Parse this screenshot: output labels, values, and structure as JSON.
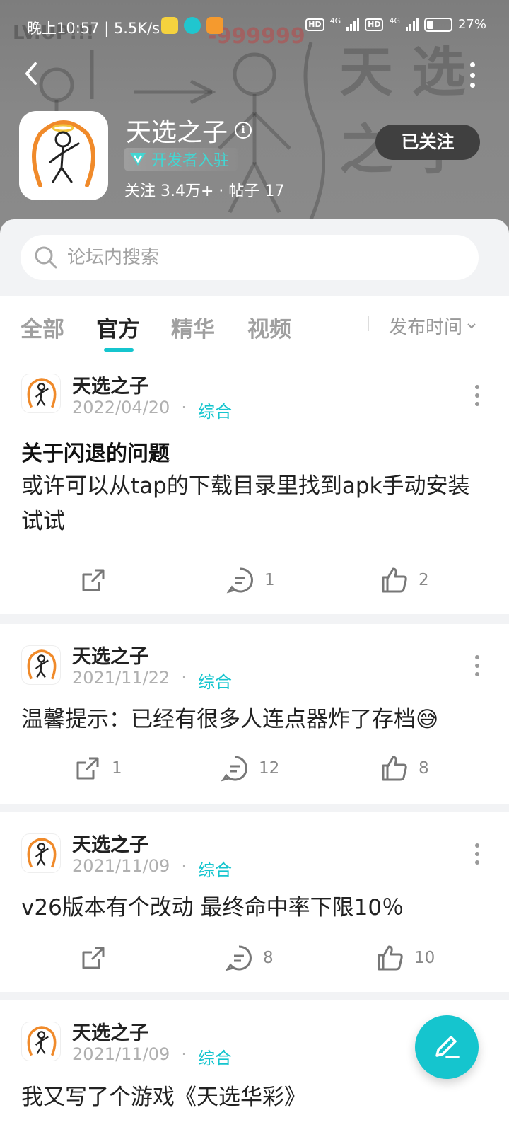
{
  "status_bar": {
    "time": "晚上10:57 | 5.5K/s",
    "hd1": "HD",
    "net1": "4G",
    "hd2": "HD",
    "net2": "4G",
    "battery": "27%"
  },
  "header_bg": {
    "lv_text": "LV.UP!!!",
    "neg_text": "-999999",
    "bg_char1": "天 选",
    "bg_char2": "之 子"
  },
  "app": {
    "title": "天选之子",
    "developer_badge": "开发者入驻",
    "stats": "关注 3.4万+  ·  帖子 17",
    "follow_label": "已关注"
  },
  "search": {
    "placeholder": "论坛内搜索"
  },
  "tabs": [
    {
      "label": "全部"
    },
    {
      "label": "官方"
    },
    {
      "label": "精华"
    },
    {
      "label": "视频"
    }
  ],
  "sort_label": "发布时间",
  "posts": [
    {
      "author": "天选之子",
      "date": "2022/04/20",
      "category": "综合",
      "title": "关于闪退的问题",
      "body": "或许可以从tap的下载目录里找到apk手动安装试试",
      "share": "",
      "comments": "1",
      "likes": "2"
    },
    {
      "author": "天选之子",
      "date": "2021/11/22",
      "category": "综合",
      "title": "",
      "body": "温馨提示：已经有很多人连点器炸了存档😅",
      "share": "1",
      "comments": "12",
      "likes": "8"
    },
    {
      "author": "天选之子",
      "date": "2021/11/09",
      "category": "综合",
      "title": "",
      "body": "v26版本有个改动 最终命中率下限10％",
      "share": "",
      "comments": "8",
      "likes": "10"
    },
    {
      "author": "天选之子",
      "date": "2021/11/09",
      "category": "综合",
      "title": "",
      "body": "我又写了个游戏《天选华彩》"
    }
  ],
  "colors": {
    "accent": "#15c5ce",
    "follow_bg": "#404040",
    "header_bg": "#858585"
  }
}
